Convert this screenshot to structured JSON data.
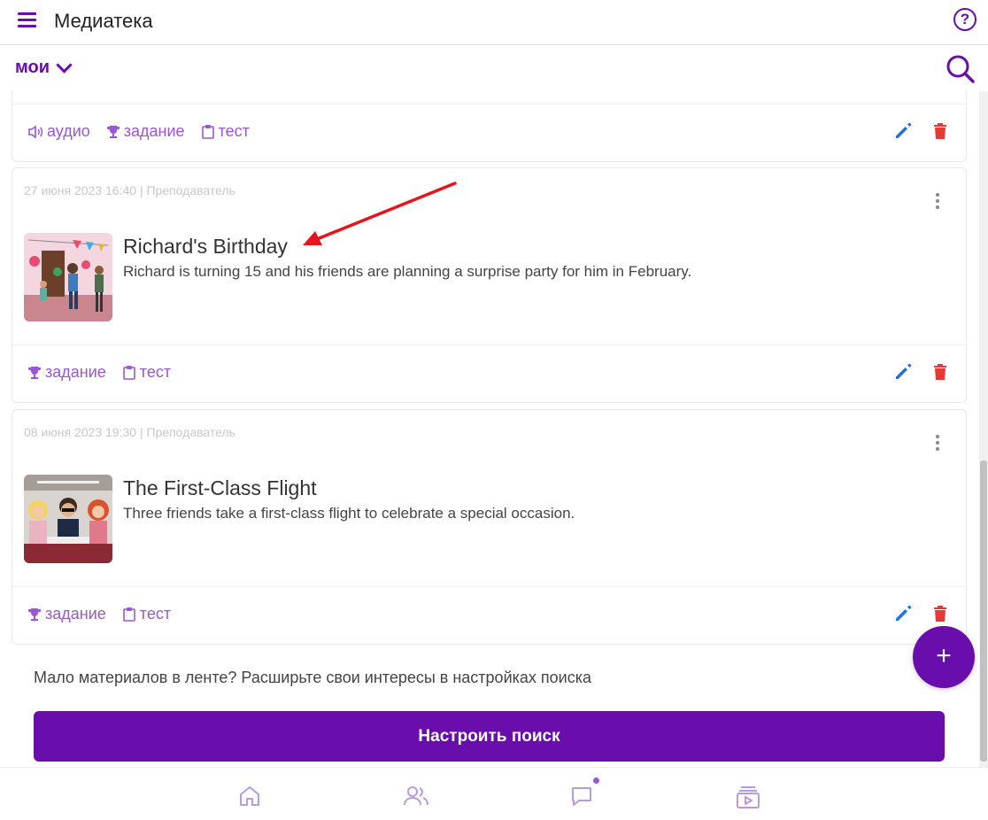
{
  "header": {
    "title": "Медиатека",
    "menu_icon": "hamburger-icon",
    "help_icon": "help-circle-icon"
  },
  "filter": {
    "selected": "мои",
    "search_icon": "search-icon"
  },
  "cards": [
    {
      "tags": [
        {
          "label": "аудио",
          "icon": "speaker-icon"
        },
        {
          "label": "задание",
          "icon": "trophy-icon"
        },
        {
          "label": "тест",
          "icon": "clipboard-icon"
        }
      ]
    },
    {
      "meta": "27 июня 2023 16:40 | Преподаватель",
      "title": "Richard's Birthday",
      "description": "Richard is turning 15 and his friends are planning a surprise party for him in February.",
      "tags": [
        {
          "label": "задание",
          "icon": "trophy-icon"
        },
        {
          "label": "тест",
          "icon": "clipboard-icon"
        }
      ]
    },
    {
      "meta": "08 июня 2023 19:30 | Преподаватель",
      "title": "The First-Class Flight",
      "description": "Three friends take a first-class flight to celebrate a special occasion.",
      "tags": [
        {
          "label": "задание",
          "icon": "trophy-icon"
        },
        {
          "label": "тест",
          "icon": "clipboard-icon"
        }
      ]
    }
  ],
  "hint": "Мало материалов в ленте? Расширьте свои интересы в настройках поиска",
  "cta_label": "Настроить поиск",
  "fab_label": "+",
  "colors": {
    "accent": "#6a0dad",
    "tag": "#9a56d8",
    "edit": "#1a73e8",
    "delete": "#e53935",
    "annotation_arrow": "#e8131b"
  },
  "bottom_nav": [
    "home-icon",
    "people-icon",
    "chat-icon",
    "media-library-icon"
  ]
}
